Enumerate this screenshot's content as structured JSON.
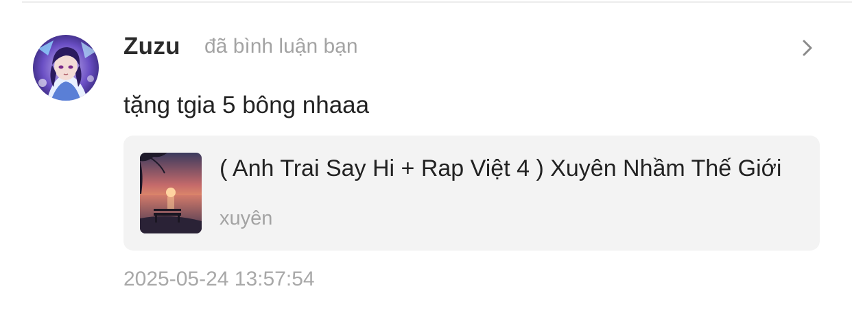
{
  "notification": {
    "user_name": "Zuzu",
    "action": "đã bình luận bạn",
    "avatar_icon": "anime-character-avatar",
    "open_icon": "chevron-right-icon",
    "comment": "tặng tgia 5 bông nhaaa",
    "timestamp": "2025-05-24 13:57:54"
  },
  "song": {
    "title": "( Anh Trai Say Hi + Rap Việt 4 ) Xuyên Nhầm Thế Giới",
    "artist": "xuyên",
    "cover_icon": "sunset-lake-bench-cover"
  },
  "colors": {
    "card_background": "#f3f3f3",
    "muted_text": "#a3a3a3",
    "primary_text": "#222222"
  }
}
